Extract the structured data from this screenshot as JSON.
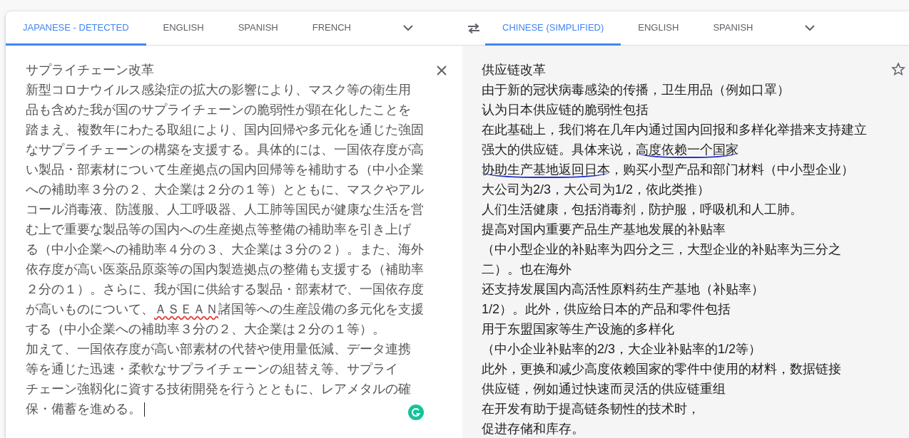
{
  "source_tabs": [
    {
      "label": "JAPANESE - DETECTED",
      "selected": true
    },
    {
      "label": "ENGLISH",
      "selected": false
    },
    {
      "label": "SPANISH",
      "selected": false
    },
    {
      "label": "FRENCH",
      "selected": false
    }
  ],
  "target_tabs": [
    {
      "label": "CHINESE (SIMPLIFIED)",
      "selected": true
    },
    {
      "label": "ENGLISH",
      "selected": false
    },
    {
      "label": "SPANISH",
      "selected": false
    }
  ],
  "source_lines": [
    [
      {
        "text": "サプライチェーン改革",
        "misspelled": false
      }
    ],
    [
      {
        "text": "新型コロナウイルス感染症の拡大の影響により、マスク等の衛生用",
        "misspelled": false
      }
    ],
    [
      {
        "text": "品も含めた我が国のサプライチェーンの脆弱性が顕在化したことを",
        "misspelled": false
      }
    ],
    [
      {
        "text": "踏まえ、複数年にわたる取組により、国内回帰や多元化を通じた強固",
        "misspelled": false
      }
    ],
    [
      {
        "text": "なサプライチェーンの構築を支援する。具体的には、一国依存度が高",
        "misspelled": false
      }
    ],
    [
      {
        "text": "い製品・部素材について生産拠点の国内回帰等を補助する（中小企業",
        "misspelled": false
      }
    ],
    [
      {
        "text": "への補助率３分の２、大企業は２分の１等）とともに、マスクやアル",
        "misspelled": false
      }
    ],
    [
      {
        "text": "コール消毒液、防護服、人工呼吸器、人工肺等国民が健康な生活を営",
        "misspelled": false
      }
    ],
    [
      {
        "text": "む上で重要な製品等の国内への生産拠点等整備の補助率を引き上げ",
        "misspelled": false
      }
    ],
    [
      {
        "text": "る（中小企業への補助率４分の３、大企業は３分の２）。また、海外",
        "misspelled": false
      }
    ],
    [
      {
        "text": "依存度が高い医薬品原薬等の国内製造拠点の整備も支援する（補助率",
        "misspelled": false
      }
    ],
    [
      {
        "text": "２分の１）。さらに、我が国に供給する製品・部素材で、一国依存度",
        "misspelled": false
      }
    ],
    [
      {
        "text": "が高いものについて、",
        "misspelled": false
      },
      {
        "text": "ＡＳＥＡＮ",
        "misspelled": true
      },
      {
        "text": "諸国等への生産設備の多元化を支援",
        "misspelled": false
      }
    ],
    [
      {
        "text": "する（中小企業への補助率３分の２、大企業は２分の１等）。",
        "misspelled": false
      }
    ],
    [
      {
        "text": "加えて、一国依存度が高い部素材の代替や使用量低減、データ連携",
        "misspelled": false
      }
    ],
    [
      {
        "text": "等を通じた迅速・柔軟なサプライチェーンの組替え等、サプライ",
        "misspelled": false
      }
    ],
    [
      {
        "text": "チェーン強靱化に資する技術開発を行うとともに、レアメタルの確",
        "misspelled": false
      }
    ],
    [
      {
        "text": "保・備蓄を進める。",
        "misspelled": false
      }
    ]
  ],
  "target_lines": [
    [
      {
        "text": "供应链改革",
        "highlighted": false
      }
    ],
    [
      {
        "text": "由于新的冠状病毒感染的传播，卫生用品（例如口罩）",
        "highlighted": false
      }
    ],
    [
      {
        "text": "认为日本供应链的脆弱性包括",
        "highlighted": false
      }
    ],
    [
      {
        "text": "在此基础上，我们将在几年内通过国内回报和多样化举措来支持建立",
        "highlighted": false
      }
    ],
    [
      {
        "text": "强大的供应链。具体来说，",
        "highlighted": false
      },
      {
        "text": "高度依赖一个国家",
        "highlighted": true
      }
    ],
    [
      {
        "text": "协助生产基地返回日本",
        "highlighted": true
      },
      {
        "text": "，购买小型产品和部门材料（中小型企业）",
        "highlighted": false
      }
    ],
    [
      {
        "text": "大公司为2/3，大公司为1/2，依此类推）",
        "highlighted": false
      }
    ],
    [
      {
        "text": "人们生活健康，包括消毒剂，防护服，呼吸机和人工肺。",
        "highlighted": false
      }
    ],
    [
      {
        "text": "提高对国内重要产品生产基地发展的补贴率",
        "highlighted": false
      }
    ],
    [
      {
        "text": "（中小型企业的补贴率为四分之三，大型企业的补贴率为三分之",
        "highlighted": false
      }
    ],
    [
      {
        "text": "二）。也在海外",
        "highlighted": false
      }
    ],
    [
      {
        "text": "还支持发展国内高活性原料药生产基地（补贴率）",
        "highlighted": false
      }
    ],
    [
      {
        "text": "1/2）。此外，供应给日本的产品和零件包括",
        "highlighted": false
      }
    ],
    [
      {
        "text": "用于东盟国家等生产设施的多样化",
        "highlighted": false
      }
    ],
    [
      {
        "text": "（中小企业补贴率的2/3，大企业补贴率的1/2等）",
        "highlighted": false
      }
    ],
    [
      {
        "text": "此外，更换和减少高度依赖国家的零件中使用的材料，数据链接",
        "highlighted": false
      }
    ],
    [
      {
        "text": "供应链，例如通过快速而灵活的供应链重组",
        "highlighted": false
      }
    ],
    [
      {
        "text": "在开发有助于提高链条韧性的技术时，",
        "highlighted": false
      }
    ],
    [
      {
        "text": "促进存储和库存。",
        "highlighted": false
      }
    ]
  ]
}
